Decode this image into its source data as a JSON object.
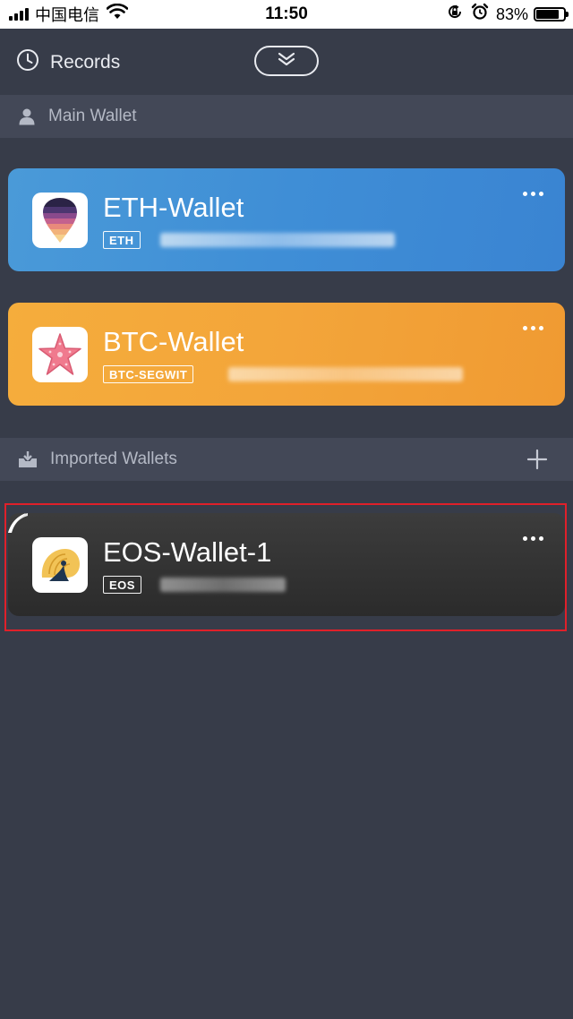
{
  "status_bar": {
    "carrier": "中国电信",
    "time": "11:50",
    "battery_pct": "83%",
    "battery_level": 0.83,
    "icons": [
      "signal-icon",
      "wifi-icon",
      "orientation-lock-icon",
      "alarm-icon",
      "battery-icon"
    ]
  },
  "header": {
    "records_label": "Records",
    "records_icon": "clock-icon",
    "toggle_icon": "double-chevron-down-icon"
  },
  "sections": {
    "main": {
      "label": "Main Wallet",
      "icon": "user-icon"
    },
    "imported": {
      "label": "Imported Wallets",
      "icon": "download-icon",
      "action_icon": "plus-icon"
    }
  },
  "wallets": [
    {
      "name": "ETH-Wallet",
      "tag": "ETH",
      "logo": "eth-balloon-logo",
      "color": "#3f8ed6"
    },
    {
      "name": "BTC-Wallet",
      "tag": "BTC-SEGWIT",
      "logo": "starfish-logo",
      "color": "#f3a53a"
    },
    {
      "name": "EOS-Wallet-1",
      "tag": "EOS",
      "logo": "nautilus-shell-logo",
      "color": "#333333"
    }
  ],
  "colors": {
    "background": "#373c49",
    "section_bar": "#434857",
    "highlight": "#e0202a"
  }
}
